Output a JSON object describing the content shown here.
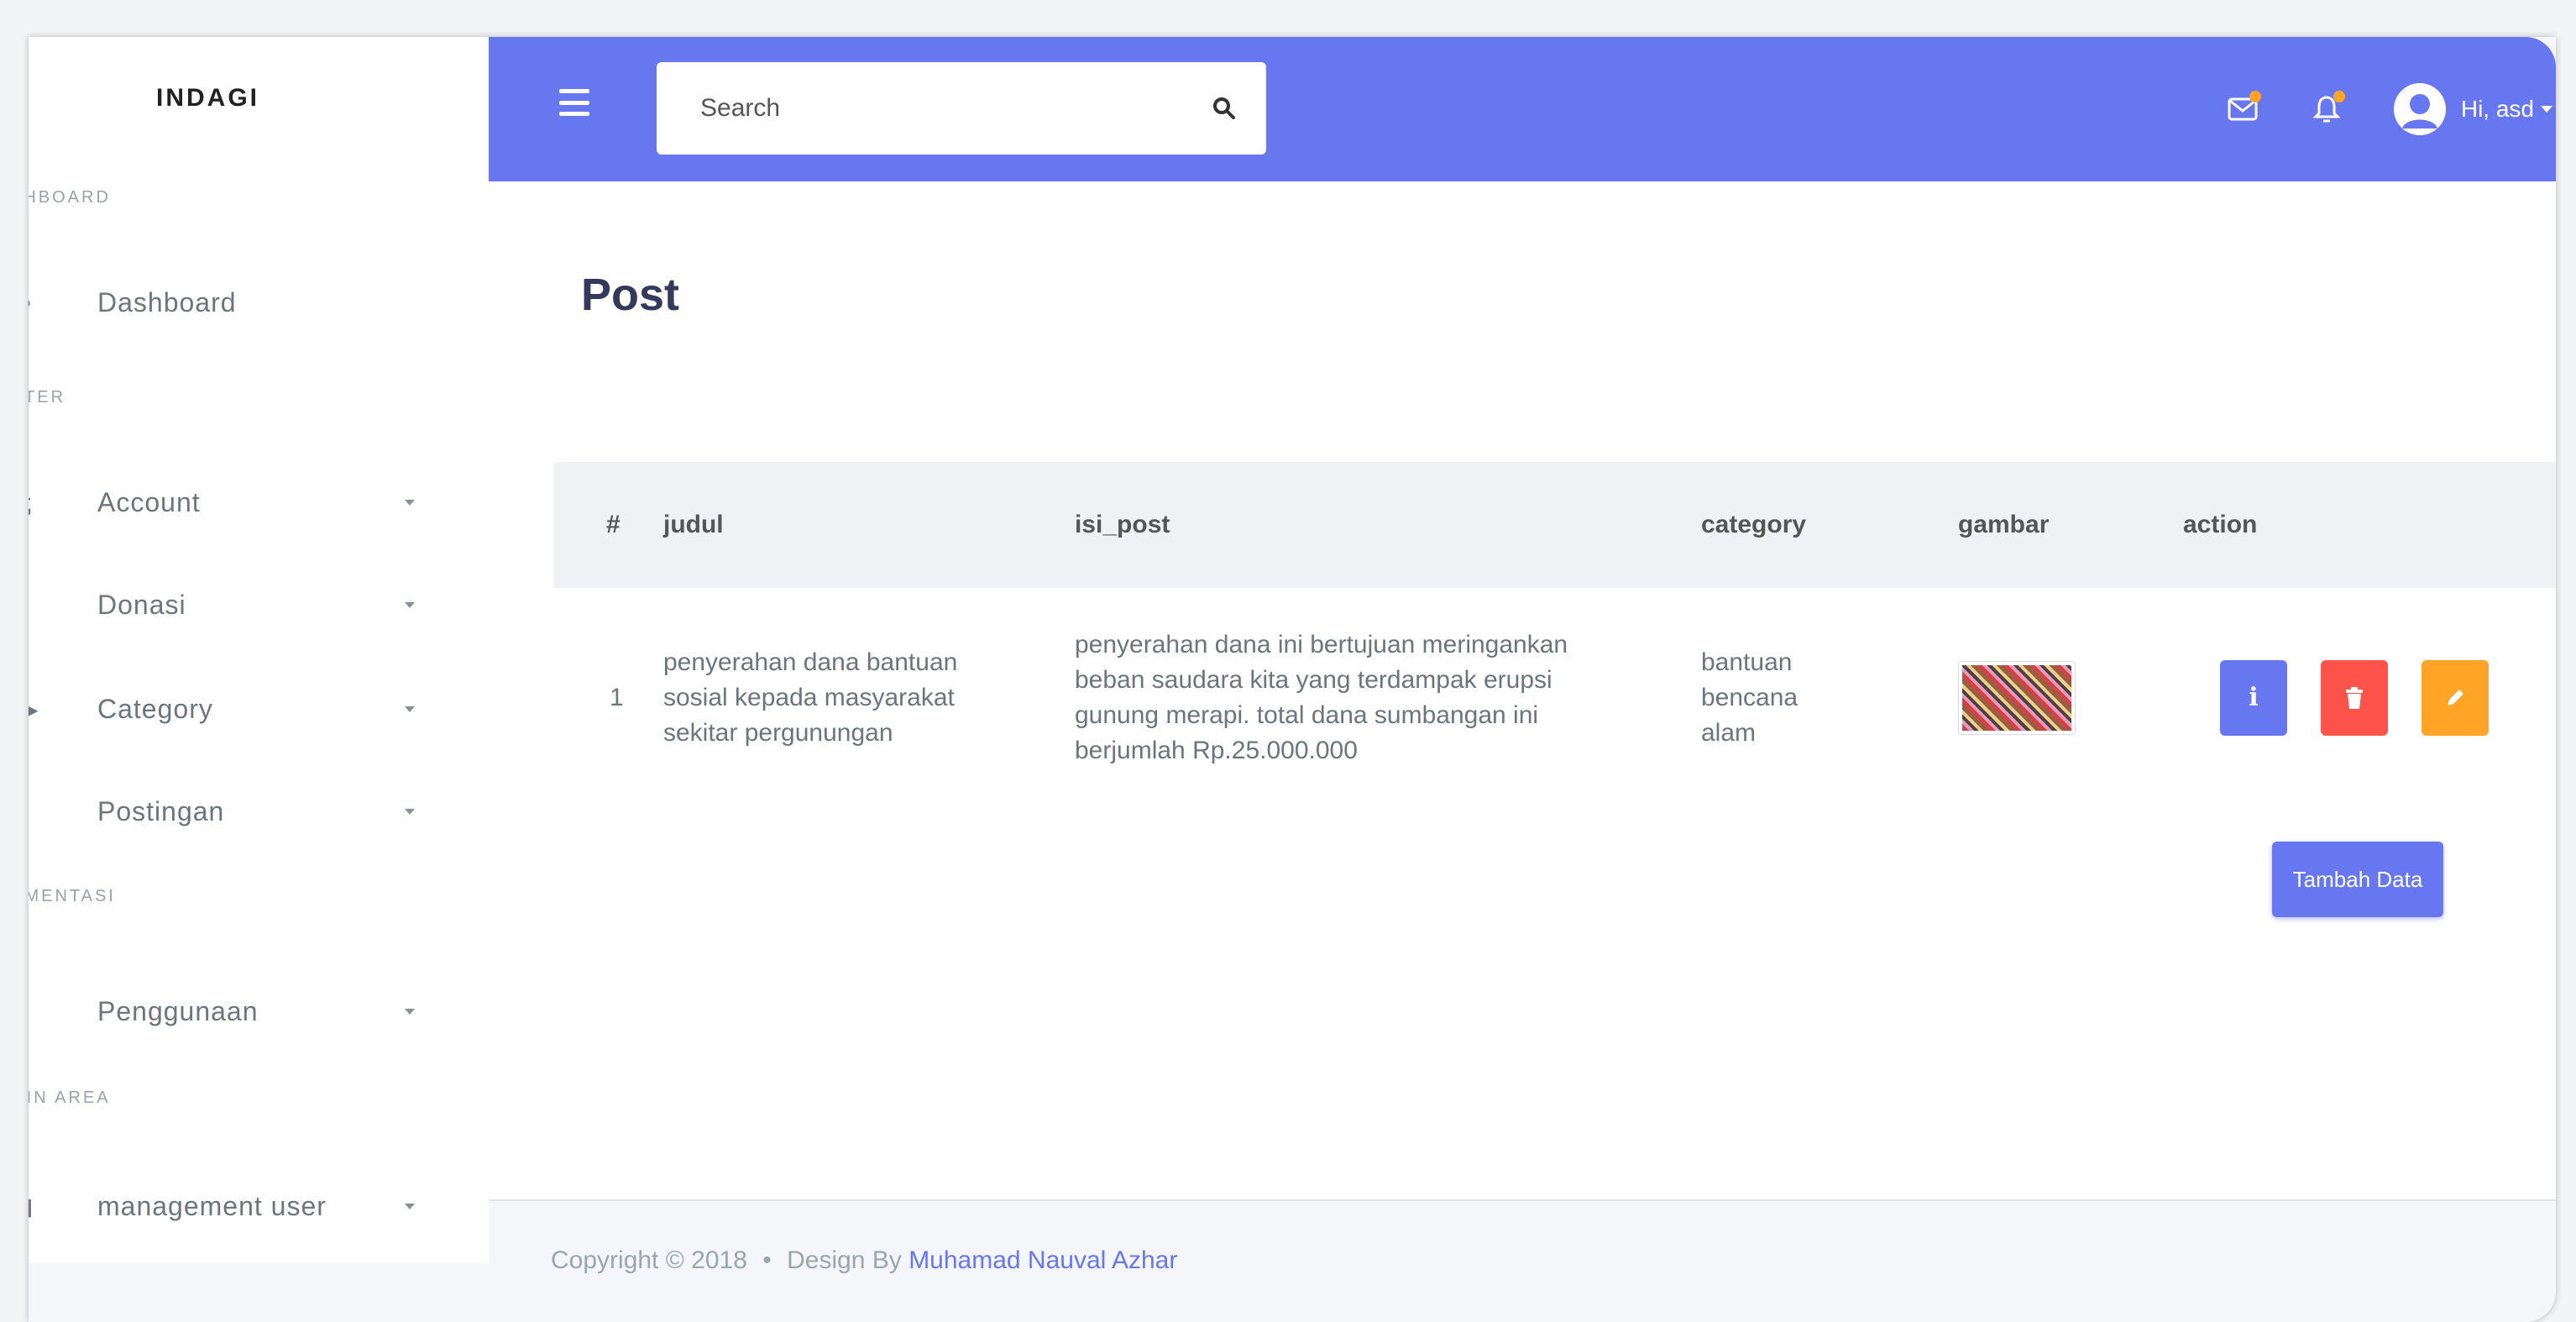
{
  "sidebar": {
    "brand": "INDAGI",
    "headers": [
      "SHBOARD",
      "RTER",
      "UMENTASI",
      "MIN AREA"
    ],
    "items": [
      {
        "label": "Dashboard"
      },
      {
        "label": "Account"
      },
      {
        "label": "Donasi"
      },
      {
        "label": "Category"
      },
      {
        "label": "Postingan"
      },
      {
        "label": "Penggunaan"
      },
      {
        "label": "management user"
      }
    ]
  },
  "topbar": {
    "search_placeholder": "Search",
    "user_greeting": "Hi, asd",
    "accent": "#6777ef"
  },
  "page": {
    "title": "Post"
  },
  "table": {
    "headers": [
      "#",
      "judul",
      "isi_post",
      "category",
      "gambar",
      "action"
    ],
    "rows": [
      {
        "no": "1",
        "judul": "penyerahan dana bantuan sosial kepada masyarakat sekitar pergunungan",
        "isi_post": "penyerahan dana ini bertujuan meringankan beban saudara kita yang terdampak erupsi gunung merapi. total dana sumbangan ini berjumlah Rp.25.000.000",
        "category": "bantuan bencana alam",
        "info_label": "i"
      }
    ]
  },
  "add_button": "Tambah Data",
  "footer": {
    "copyright": "Copyright © 2018",
    "separator": "•",
    "design_by": "Design By",
    "author": "Muhamad Nauval Azhar"
  }
}
